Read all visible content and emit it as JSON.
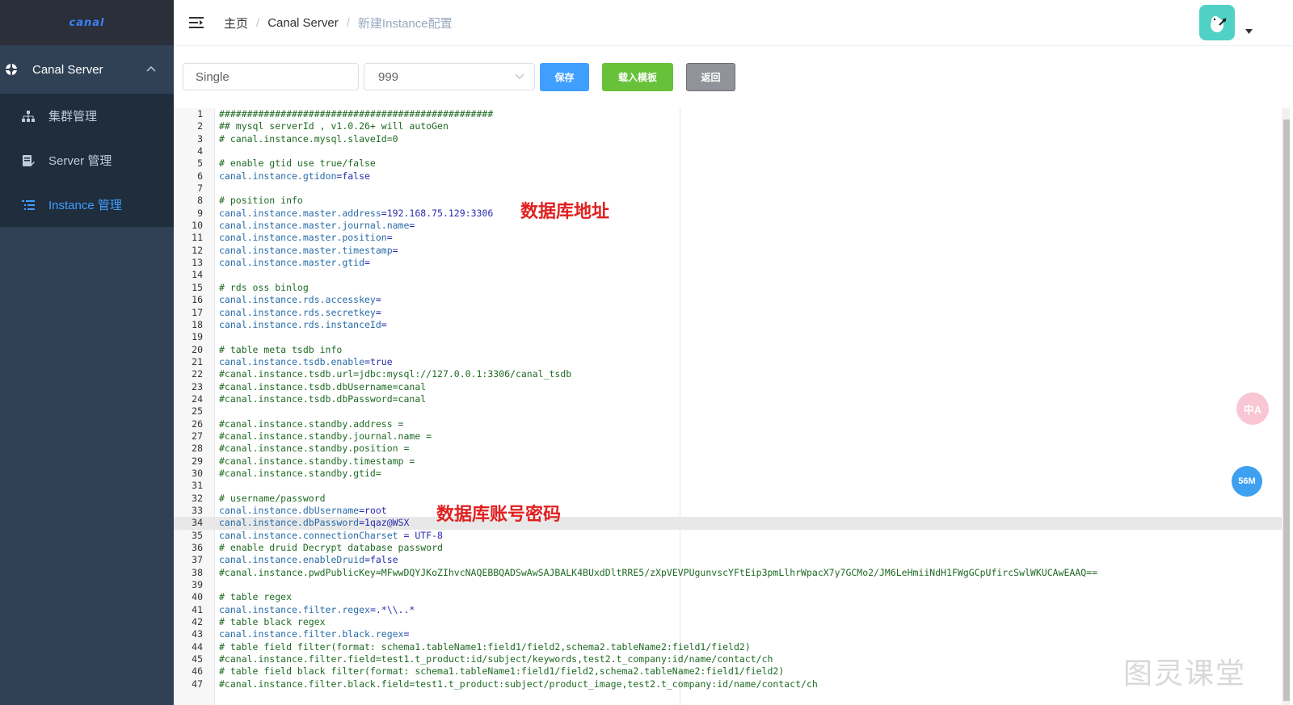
{
  "sidebar": {
    "logo": "canal",
    "menu_root": "Canal Server",
    "items": [
      {
        "label": "集群管理",
        "icon": "sitemap-icon"
      },
      {
        "label": "Server 管理",
        "icon": "file-edit-icon"
      },
      {
        "label": "Instance 管理",
        "icon": "list-icon",
        "active": true
      }
    ]
  },
  "breadcrumb": [
    "主页",
    "Canal Server",
    "新建Instance配置"
  ],
  "breadcrumb_sep": "/",
  "form": {
    "name_value": "Single",
    "cluster_value": "999",
    "save_label": "保存",
    "load_template_label": "载入模板",
    "back_label": "返回"
  },
  "annotations": {
    "db_address": "数据库地址",
    "db_credentials": "数据库账号密码"
  },
  "floating": {
    "translate": "中A",
    "memory": "56M"
  },
  "watermark": "图灵课堂",
  "editor": {
    "current_line": 34,
    "lines": [
      "#################################################",
      "## mysql serverId , v1.0.26+ will autoGen",
      "# canal.instance.mysql.slaveId=0",
      "",
      "# enable gtid use true/false",
      "canal.instance.gtidon=false",
      "",
      "# position info",
      "canal.instance.master.address=192.168.75.129:3306",
      "canal.instance.master.journal.name=",
      "canal.instance.master.position=",
      "canal.instance.master.timestamp=",
      "canal.instance.master.gtid=",
      "",
      "# rds oss binlog",
      "canal.instance.rds.accesskey=",
      "canal.instance.rds.secretkey=",
      "canal.instance.rds.instanceId=",
      "",
      "# table meta tsdb info",
      "canal.instance.tsdb.enable=true",
      "#canal.instance.tsdb.url=jdbc:mysql://127.0.0.1:3306/canal_tsdb",
      "#canal.instance.tsdb.dbUsername=canal",
      "#canal.instance.tsdb.dbPassword=canal",
      "",
      "#canal.instance.standby.address =",
      "#canal.instance.standby.journal.name =",
      "#canal.instance.standby.position =",
      "#canal.instance.standby.timestamp =",
      "#canal.instance.standby.gtid=",
      "",
      "# username/password",
      "canal.instance.dbUsername=root",
      "canal.instance.dbPassword=1qaz@WSX",
      "canal.instance.connectionCharset = UTF-8",
      "# enable druid Decrypt database password",
      "canal.instance.enableDruid=false",
      "#canal.instance.pwdPublicKey=MFwwDQYJKoZIhvcNAQEBBQADSwAwSAJBALK4BUxdDltRRE5/zXpVEVPUgunvscYFtEip3pmLlhrWpacX7y7GCMo2/JM6LeHmiiNdH1FWgGCpUfircSwlWKUCAwEAAQ==",
      "",
      "# table regex",
      "canal.instance.filter.regex=.*\\\\..*",
      "# table black regex",
      "canal.instance.filter.black.regex=",
      "# table field filter(format: schema1.tableName1:field1/field2,schema2.tableName2:field1/field2)",
      "#canal.instance.filter.field=test1.t_product:id/subject/keywords,test2.t_company:id/name/contact/ch",
      "# table field black filter(format: schema1.tableName1:field1/field2,schema2.tableName2:field1/field2)",
      "#canal.instance.filter.black.field=test1.t_product:subject/product_image,test2.t_company:id/name/contact/ch"
    ]
  }
}
